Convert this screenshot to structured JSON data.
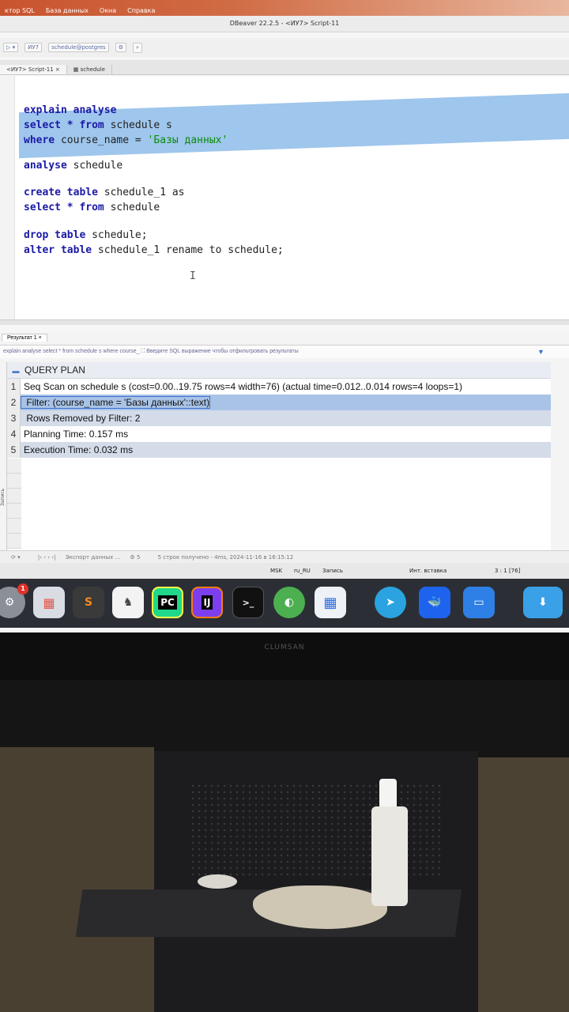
{
  "menubar": {
    "items": [
      "ктор SQL",
      "База данных",
      "Окна",
      "Справка"
    ]
  },
  "window": {
    "title": "DBeaver 22.2.5 - <ИУ7> Script-11"
  },
  "toolbar": {
    "items": [
      "ИУ7",
      "schedule@postgres"
    ]
  },
  "tabs": [
    {
      "label": "<ИУ7> Script-11"
    },
    {
      "label": "schedule"
    }
  ],
  "editor": {
    "lines": [
      {
        "kw": "explain analyse",
        "rest": ""
      },
      {
        "kw": "select * from",
        "rest": " schedule s"
      },
      {
        "kw": "where",
        "rest": " course_name = ",
        "str": "'Базы данных'"
      },
      {
        "kw": "analyse",
        "rest": " schedule"
      },
      {
        "kw": "create table",
        "rest": " schedule_1 as"
      },
      {
        "kw": "select * from",
        "rest": " schedule"
      },
      {
        "kw": "drop table",
        "rest": " schedule;"
      },
      {
        "kw": "alter table",
        "rest": " schedule_1 rename to schedule;"
      }
    ]
  },
  "results": {
    "tab_label": "Результат 1",
    "filter_query": "explain analyse select * from schedule s where course_",
    "filter_placeholder": "Введите SQL выражение чтобы отфильтровать результаты",
    "column_header": "QUERY PLAN",
    "rows": [
      {
        "num": "1",
        "value": "Seq Scan on schedule s  (cost=0.00..19.75 rows=4 width=76) (actual time=0.012..0.014 rows=4 loops=1)"
      },
      {
        "num": "2",
        "value": "  Filter: (course_name = 'Базы данных'::text)"
      },
      {
        "num": "3",
        "value": "  Rows Removed by Filter: 2"
      },
      {
        "num": "4",
        "value": "Planning Time: 0.157 ms"
      },
      {
        "num": "5",
        "value": "Execution Time: 0.032 ms"
      }
    ],
    "side_label": "Запись",
    "bottom_export": "Экспорт данных ...",
    "bottom_count": "5",
    "bottom_status": "5 строк получено - 4ms, 2024-11-16 в 16:15:12"
  },
  "statusbar": {
    "tz": "MSK",
    "locale": "ru_RU",
    "mode": "Запись",
    "insert": "Инт. вставка",
    "position": "3 : 1 [76]"
  },
  "dock": {
    "badge": "1",
    "icons": [
      "system-settings-icon",
      "launchpad-icon",
      "sublime-text-icon",
      "sequel-ace-icon",
      "pycharm-icon",
      "intellij-idea-icon",
      "terminal-icon",
      "browser-icon",
      "windows-app-icon",
      "telegram-icon",
      "docker-icon",
      "keynote-icon",
      "downloads-folder-icon"
    ],
    "pycharm_label": "PC",
    "intellij_label": "IJ",
    "terminal_label": ">_"
  },
  "monitor": {
    "brand": "CLUMSAN"
  }
}
